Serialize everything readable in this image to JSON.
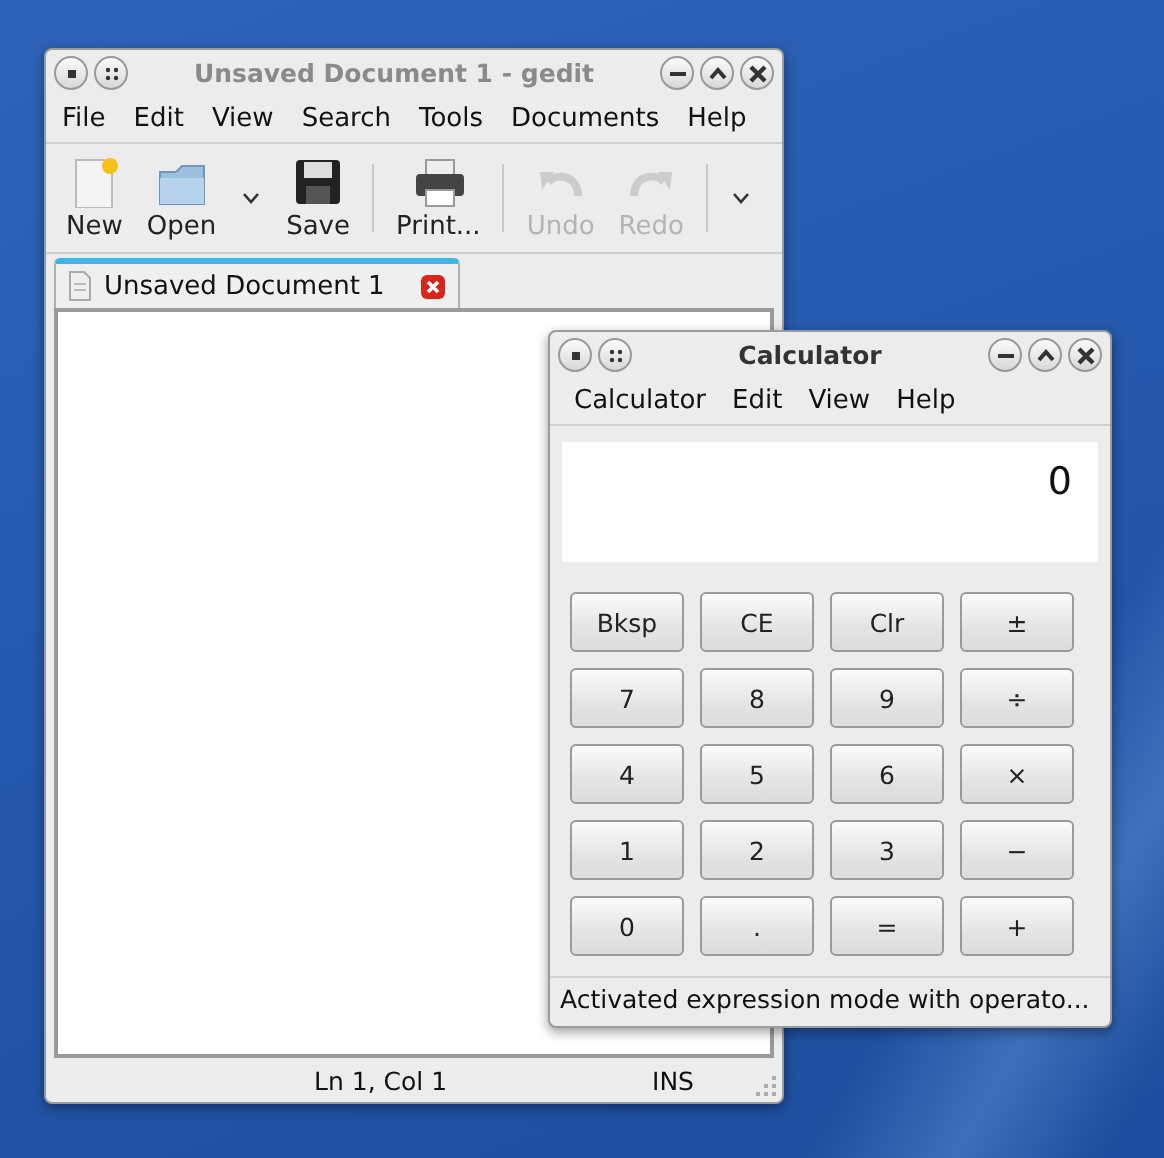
{
  "editor": {
    "title": "Unsaved Document 1 - gedit",
    "menu": [
      "File",
      "Edit",
      "View",
      "Search",
      "Tools",
      "Documents",
      "Help"
    ],
    "toolbar": [
      {
        "kind": "button",
        "label": "New",
        "disabled": false
      },
      {
        "kind": "button",
        "label": "Open",
        "disabled": false
      },
      {
        "kind": "dropdown"
      },
      {
        "kind": "button",
        "label": "Save",
        "disabled": false
      },
      {
        "kind": "separator"
      },
      {
        "kind": "button",
        "label": "Print...",
        "disabled": false
      },
      {
        "kind": "separator"
      },
      {
        "kind": "button",
        "label": "Undo",
        "disabled": true
      },
      {
        "kind": "button",
        "label": "Redo",
        "disabled": true
      },
      {
        "kind": "separator"
      },
      {
        "kind": "dropdown"
      }
    ],
    "tabs": [
      {
        "label": "Unsaved Document 1",
        "selected": true
      }
    ],
    "status_bar": {
      "position": "Ln 1, Col 1",
      "mode": "INS"
    }
  },
  "calculator": {
    "title": "Calculator",
    "menu": [
      "Calculator",
      "Edit",
      "View",
      "Help"
    ],
    "display": "0",
    "buttons": [
      "Bksp",
      "CE",
      "Clr",
      "±",
      "7",
      "8",
      "9",
      "÷",
      "4",
      "5",
      "6",
      "×",
      "1",
      "2",
      "3",
      "−",
      "0",
      ".",
      "=",
      "+"
    ],
    "status_bar": "Activated expression mode with operato..."
  }
}
